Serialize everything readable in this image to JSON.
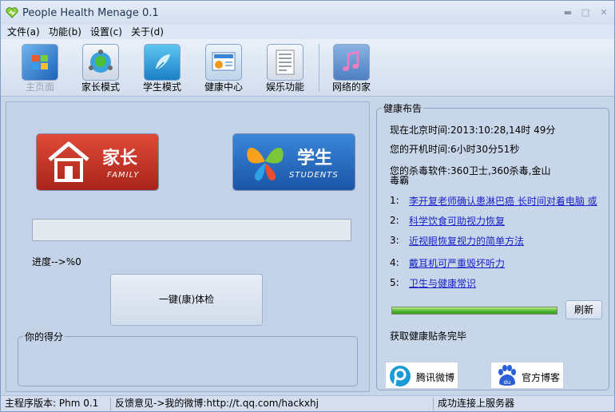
{
  "window": {
    "title": "People Health Menage 0.1",
    "controls": [
      "minimize-icon",
      "restore-icon",
      "close-icon"
    ]
  },
  "menu": [
    {
      "label": "文件(a)"
    },
    {
      "label": "功能(b)"
    },
    {
      "label": "设置(c)"
    },
    {
      "label": "关于(d)"
    }
  ],
  "toolbar": {
    "items": [
      {
        "label": "主页面",
        "icon": "home-window-icon",
        "disabled": true
      },
      {
        "label": "家长模式",
        "icon": "parent-mode-icon"
      },
      {
        "label": "学生模式",
        "icon": "student-mode-icon"
      },
      {
        "label": "健康中心",
        "icon": "health-center-icon"
      },
      {
        "label": "娱乐功能",
        "icon": "entertainment-icon"
      },
      {
        "label": "网络的家",
        "icon": "music-note-icon"
      }
    ]
  },
  "left": {
    "parent_button": {
      "main": "家长",
      "sub": "FAMILY"
    },
    "student_button": {
      "main": "学生",
      "sub": "STUDENTS"
    },
    "progress_text": "进度-->%0",
    "checkup_label": "一键(康)体检",
    "score_legend": "你的得分"
  },
  "right": {
    "legend": "健康布告",
    "beijing_time": "现在北京时间:2013:10:28,14时 49分",
    "uptime": "您的开机时间:6小时30分51秒",
    "antivirus_line1": "您的杀毒软件:360卫士,360杀毒,金山",
    "antivirus_line2": "毒霸",
    "news": [
      {
        "num": "1:",
        "title": "李开复老师确认患淋巴癌 长时间对着电脑 或"
      },
      {
        "num": "2:",
        "title": "科学饮食可助视力恢复"
      },
      {
        "num": "3:",
        "title": "近视眼恢复视力的简单方法"
      },
      {
        "num": "4:",
        "title": "戴耳机可严重毁坏听力"
      },
      {
        "num": "5:",
        "title": "卫生与健康常识"
      }
    ],
    "fetch_progress": 1.0,
    "refresh_label": "刷新",
    "fetch_status": "获取健康贴条完毕",
    "weibo_label": "腾讯微博",
    "blog_label": "官方博客"
  },
  "status": {
    "version": "主程序版本: Phm 0.1",
    "feedback": "反馈意见->我的微博:http://t.qq.com/hackxhj",
    "connection": "成功连接上服务器"
  },
  "colors": {
    "accent_link": "#1a22c8",
    "parent_red": "#c8301f",
    "student_blue": "#2c6bc4",
    "progress_green": "#4cb12c"
  }
}
